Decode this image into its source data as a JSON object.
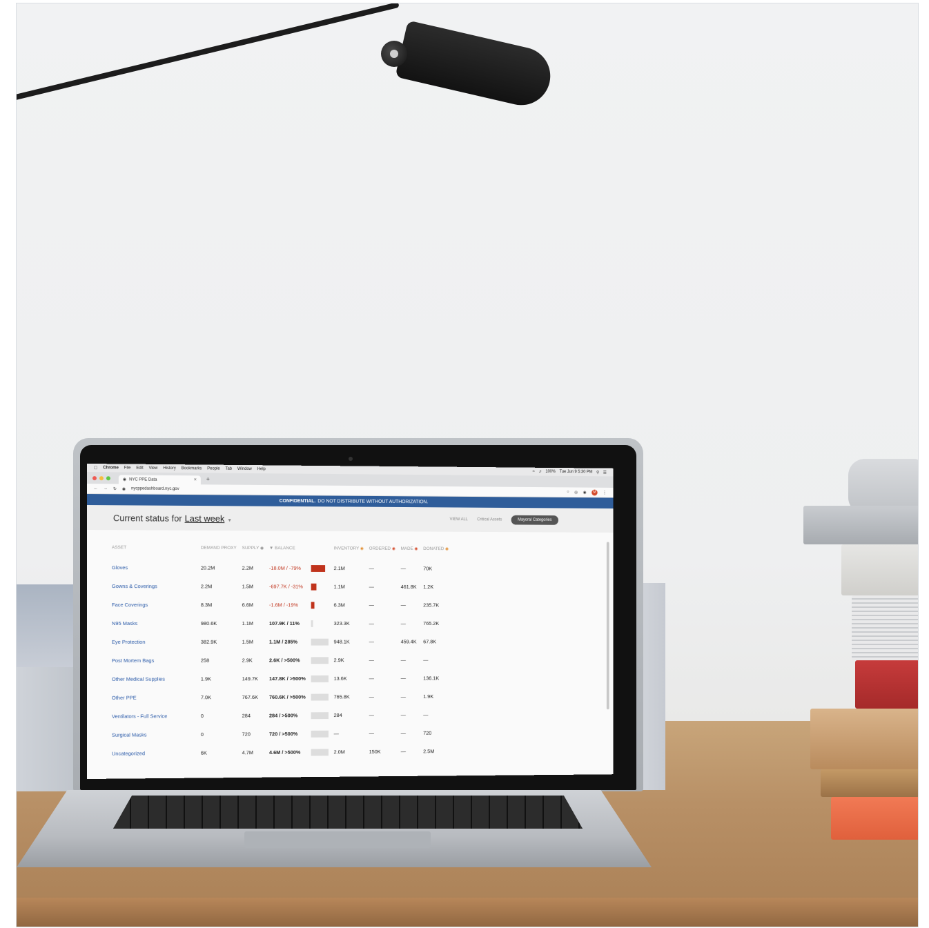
{
  "menubar": {
    "app": "Chrome",
    "items": [
      "File",
      "Edit",
      "View",
      "History",
      "Bookmarks",
      "People",
      "Tab",
      "Window",
      "Help"
    ],
    "battery": "100%",
    "clock": "Tue Jun 9 5:30 PM"
  },
  "browser": {
    "tab_title": "NYC PPE Data",
    "url": "nycppedashboard.nyc.gov",
    "avatar_letter": "M"
  },
  "banner": {
    "strong": "CONFIDENTIAL.",
    "text": "DO NOT DISTRIBUTE WITHOUT AUTHORIZATION."
  },
  "status": {
    "prefix": "Current status for",
    "period": "Last week",
    "view_all": "VIEW ALL",
    "critical": "Critical Assets",
    "mayoral": "Mayoral Categories"
  },
  "table": {
    "headers": {
      "asset": "ASSET",
      "demand": "DEMAND PROXY",
      "supply": "SUPPLY",
      "balance": "BALANCE",
      "inventory": "INVENTORY",
      "ordered": "ORDERED",
      "made": "MADE",
      "donated": "DONATED"
    },
    "rows": [
      {
        "asset": "Gloves",
        "demand": "20.2M",
        "supply": "2.2M",
        "balance": "-18.0M / -79%",
        "inventory": "2.1M",
        "ordered": "—",
        "made": "—",
        "donated": "70K"
      },
      {
        "asset": "Gowns & Coverings",
        "demand": "2.2M",
        "supply": "1.5M",
        "balance": "-697.7K / -31%",
        "inventory": "1.1M",
        "ordered": "—",
        "made": "461.8K",
        "donated": "1.2K"
      },
      {
        "asset": "Face Coverings",
        "demand": "8.3M",
        "supply": "6.6M",
        "balance": "-1.6M / -19%",
        "inventory": "6.3M",
        "ordered": "—",
        "made": "—",
        "donated": "235.7K"
      },
      {
        "asset": "N95 Masks",
        "demand": "980.6K",
        "supply": "1.1M",
        "balance": "107.9K / 11%",
        "inventory": "323.3K",
        "ordered": "—",
        "made": "—",
        "donated": "765.2K"
      },
      {
        "asset": "Eye Protection",
        "demand": "382.9K",
        "supply": "1.5M",
        "balance": "1.1M / 285%",
        "inventory": "948.1K",
        "ordered": "—",
        "made": "459.4K",
        "donated": "67.8K"
      },
      {
        "asset": "Post Mortem Bags",
        "demand": "258",
        "supply": "2.9K",
        "balance": "2.6K / >500%",
        "inventory": "2.9K",
        "ordered": "—",
        "made": "—",
        "donated": "—"
      },
      {
        "asset": "Other Medical Supplies",
        "demand": "1.9K",
        "supply": "149.7K",
        "balance": "147.8K / >500%",
        "inventory": "13.6K",
        "ordered": "—",
        "made": "—",
        "donated": "136.1K"
      },
      {
        "asset": "Other PPE",
        "demand": "7.0K",
        "supply": "767.6K",
        "balance": "760.6K / >500%",
        "inventory": "765.8K",
        "ordered": "—",
        "made": "—",
        "donated": "1.9K"
      },
      {
        "asset": "Ventilators - Full Service",
        "demand": "0",
        "supply": "284",
        "balance": "284 / >500%",
        "inventory": "284",
        "ordered": "—",
        "made": "—",
        "donated": "—"
      },
      {
        "asset": "Surgical Masks",
        "demand": "0",
        "supply": "720",
        "balance": "720 / >500%",
        "inventory": "—",
        "ordered": "—",
        "made": "—",
        "donated": "720"
      },
      {
        "asset": "Uncategorized",
        "demand": "6K",
        "supply": "4.7M",
        "balance": "4.6M / >500%",
        "inventory": "2.0M",
        "ordered": "150K",
        "made": "—",
        "donated": "2.5M"
      }
    ],
    "balance_bars": [
      {
        "direction": "negative",
        "fraction": 0.79,
        "color": "#c0331c"
      },
      {
        "direction": "negative",
        "fraction": 0.31,
        "color": "#c0331c"
      },
      {
        "direction": "negative",
        "fraction": 0.19,
        "color": "#c0331c"
      },
      {
        "direction": "positive",
        "fraction": 0.11,
        "color": "#dddddd"
      },
      {
        "direction": "positive",
        "fraction": 1.0,
        "color": "#dddddd"
      },
      {
        "direction": "positive",
        "fraction": 1.0,
        "color": "#dddddd"
      },
      {
        "direction": "positive",
        "fraction": 1.0,
        "color": "#dddddd"
      },
      {
        "direction": "positive",
        "fraction": 1.0,
        "color": "#dddddd"
      },
      {
        "direction": "positive",
        "fraction": 1.0,
        "color": "#dddddd"
      },
      {
        "direction": "positive",
        "fraction": 1.0,
        "color": "#dddddd"
      },
      {
        "direction": "positive",
        "fraction": 1.0,
        "color": "#dddddd"
      }
    ]
  },
  "colors": {
    "banner": "#2f5d9a",
    "asset_link": "#2a5aa8",
    "negative": "#c0331c",
    "desk": "#b89066",
    "wall": "#eeeff0"
  }
}
